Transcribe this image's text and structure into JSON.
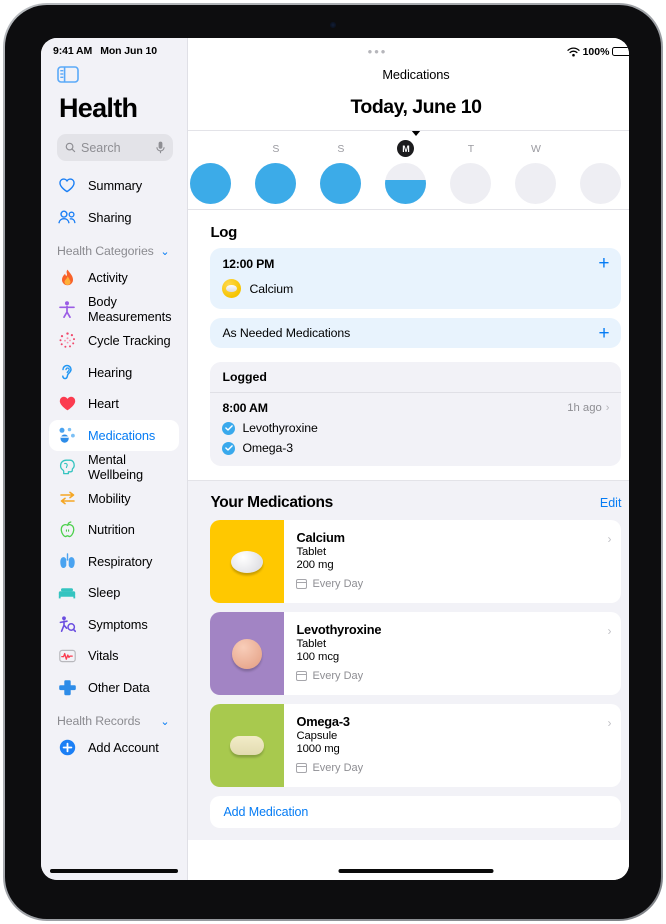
{
  "status_bar": {
    "time": "9:41 AM",
    "date": "Mon Jun 10",
    "dots": "•••",
    "battery_percent": "100%",
    "wifi_icon": "wifi-icon",
    "battery_icon": "battery-full-icon"
  },
  "sidebar": {
    "toggle_icon": "sidebar-toggle-icon",
    "title": "Health",
    "search": {
      "placeholder": "Search",
      "value": "",
      "icon": "search-icon",
      "mic_icon": "microphone-icon"
    },
    "top_items": [
      {
        "label": "Summary",
        "icon": "heart-outline-icon"
      },
      {
        "label": "Sharing",
        "icon": "people-icon"
      }
    ],
    "categories_section": {
      "label": "Health Categories",
      "chevron": "chevron-down-icon"
    },
    "categories": [
      {
        "label": "Activity",
        "icon": "flame-icon"
      },
      {
        "label": "Body Measurements",
        "icon": "body-icon"
      },
      {
        "label": "Cycle Tracking",
        "icon": "cycle-icon"
      },
      {
        "label": "Hearing",
        "icon": "ear-icon"
      },
      {
        "label": "Heart",
        "icon": "heart-filled-icon"
      },
      {
        "label": "Medications",
        "icon": "pills-icon",
        "selected": true
      },
      {
        "label": "Mental Wellbeing",
        "icon": "brain-head-icon"
      },
      {
        "label": "Mobility",
        "icon": "arrows-icon"
      },
      {
        "label": "Nutrition",
        "icon": "apple-icon"
      },
      {
        "label": "Respiratory",
        "icon": "lungs-icon"
      },
      {
        "label": "Sleep",
        "icon": "bed-icon"
      },
      {
        "label": "Symptoms",
        "icon": "symptoms-icon"
      },
      {
        "label": "Vitals",
        "icon": "waveform-icon"
      },
      {
        "label": "Other Data",
        "icon": "plus-cross-icon"
      }
    ],
    "records_section": {
      "label": "Health Records",
      "chevron": "chevron-down-icon"
    },
    "add_account": {
      "label": "Add Account",
      "icon": "plus-circle-icon"
    }
  },
  "main": {
    "nav_title": "Medications",
    "today_title": "Today, June 10",
    "calendar": {
      "caret_icon": "caret-down-icon",
      "days": [
        {
          "label": "",
          "fill_pct": 100,
          "today": false,
          "partial_edge": true
        },
        {
          "label": "S",
          "fill_pct": 100,
          "today": false
        },
        {
          "label": "S",
          "fill_pct": 100,
          "today": false
        },
        {
          "label": "M",
          "fill_pct": 58,
          "today": true
        },
        {
          "label": "T",
          "fill_pct": 0,
          "today": false
        },
        {
          "label": "W",
          "fill_pct": 0,
          "today": false
        },
        {
          "label": "",
          "fill_pct": 0,
          "today": false,
          "partial_edge": true
        }
      ]
    },
    "log": {
      "section_title": "Log",
      "entry": {
        "time": "12:00 PM",
        "add_icon": "plus-icon",
        "medication": "Calcium",
        "pill_icon": "yellow-tablet-icon"
      },
      "as_needed": {
        "label": "As Needed Medications",
        "add_icon": "plus-icon"
      }
    },
    "logged": {
      "header": "Logged",
      "time": "8:00 AM",
      "ago": "1h ago",
      "chevron": "chevron-right-icon",
      "items": [
        {
          "label": "Levothyroxine",
          "checked": true
        },
        {
          "label": "Omega-3",
          "checked": true
        }
      ]
    },
    "your_medications": {
      "title": "Your Medications",
      "edit_label": "Edit",
      "items": [
        {
          "name": "Calcium",
          "form": "Tablet",
          "dose": "200 mg",
          "frequency": "Every Day",
          "frequency_icon": "calendar-icon",
          "chevron": "chevron-right-icon",
          "thumb_color": "#FFC800",
          "shape": "tablet"
        },
        {
          "name": "Levothyroxine",
          "form": "Tablet",
          "dose": "100 mcg",
          "frequency": "Every Day",
          "frequency_icon": "calendar-icon",
          "chevron": "chevron-right-icon",
          "thumb_color": "#A284C4",
          "shape": "round"
        },
        {
          "name": "Omega-3",
          "form": "Capsule",
          "dose": "1000 mg",
          "frequency": "Every Day",
          "frequency_icon": "calendar-icon",
          "chevron": "chevron-right-icon",
          "thumb_color": "#A8C94E",
          "shape": "capsule"
        }
      ],
      "add_button": "Add Medication"
    }
  },
  "colors": {
    "accent_blue": "#067cf4",
    "progress_blue": "#3cabe8",
    "sidebar_bg": "#f2f2f7",
    "card_blue_bg": "#e8f3fd"
  }
}
